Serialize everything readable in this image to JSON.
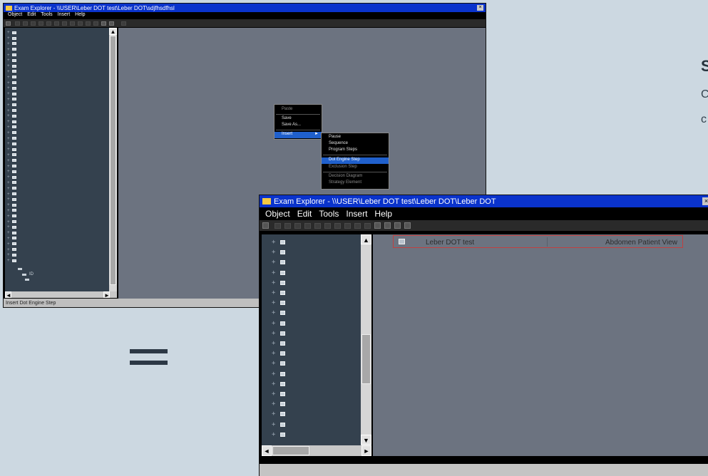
{
  "side_panel": {
    "heading": "S",
    "line1": "C",
    "line2": "c"
  },
  "back_window": {
    "title": "Exam Explorer - \\\\USER\\Leber DOT test\\Leber DOT\\sdjfhsdfhsl",
    "menu": [
      "Object",
      "Edit",
      "Tools",
      "Insert",
      "Help"
    ],
    "status": "Insert Dot Engine Step",
    "tree_last_item": "ID",
    "context_menu": [
      {
        "label": "Paste",
        "enabled": false
      },
      {
        "label": "Save",
        "enabled": true
      },
      {
        "label": "Save As...",
        "enabled": true
      },
      {
        "label": "Insert",
        "enabled": true,
        "selected": true,
        "submenu": true
      }
    ],
    "submenu": [
      {
        "label": "Pause",
        "enabled": true
      },
      {
        "label": "Sequence",
        "enabled": true
      },
      {
        "label": "Program Steps",
        "enabled": true
      },
      {
        "label": "Dot Engine Step",
        "enabled": true,
        "selected": true
      },
      {
        "label": "Exclusion Step",
        "enabled": false
      },
      {
        "label": "Decision Diagram",
        "enabled": false
      },
      {
        "label": "Strategy Element",
        "enabled": false
      }
    ]
  },
  "front_window": {
    "title": "Exam Explorer - \\\\USER\\Leber DOT test\\Leber DOT\\Leber DOT",
    "menu": [
      "Object",
      "Edit",
      "Tools",
      "Insert",
      "Help"
    ],
    "list_row": {
      "name": "Leber DOT test",
      "view": "Abdomen Patient View"
    }
  },
  "colors": {
    "title_bar": "#0a33cc",
    "tree_bg": "#34414e",
    "content_bg": "#6c7380",
    "page_bg": "#ccd8e1",
    "selection": "#2060cc"
  }
}
